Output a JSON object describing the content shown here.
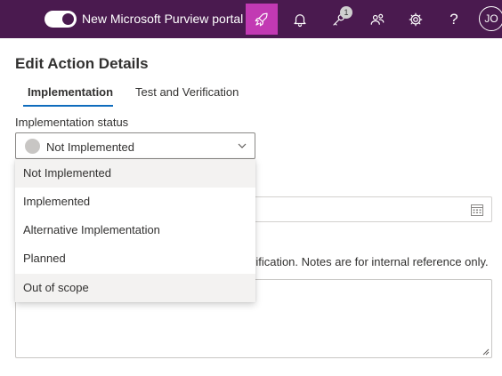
{
  "header": {
    "portal_toggle_label": "New Microsoft Purview portal",
    "notification_count": "1",
    "help_glyph": "?",
    "avatar_initials": "JO",
    "accent_color": "#4a1a4f",
    "active_icon_color": "#c239b3",
    "icons": [
      "rocket-icon",
      "bell-icon",
      "key-icon",
      "people-icon",
      "gear-icon",
      "help-icon"
    ]
  },
  "page": {
    "title": "Edit Action Details",
    "tabs": [
      {
        "label": "Implementation",
        "active": true
      },
      {
        "label": "Test and Verification",
        "active": false
      }
    ]
  },
  "form": {
    "status_label": "Implementation status",
    "status_value": "Not Implemented",
    "status_options": [
      "Not Implemented",
      "Implemented",
      "Alternative Implementation",
      "Planned",
      "Out of scope"
    ],
    "notes_hint_visible": "rification. Notes are for internal reference only."
  }
}
